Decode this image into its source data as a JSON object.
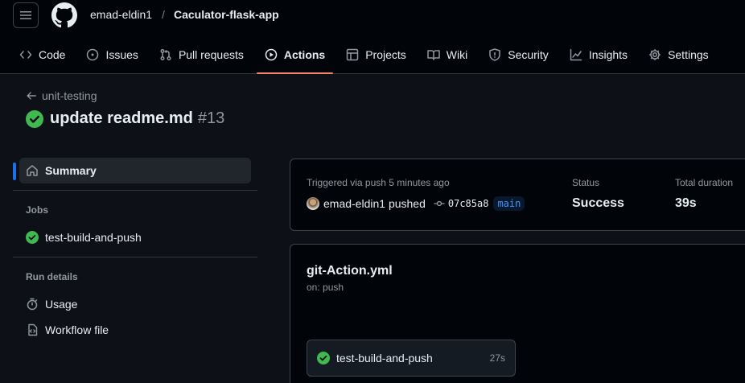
{
  "header": {
    "owner": "emad-eldin1",
    "separator": "/",
    "repo": "Caculator-flask-app"
  },
  "tabs": [
    {
      "label": "Code",
      "icon": "code-icon"
    },
    {
      "label": "Issues",
      "icon": "issue-icon"
    },
    {
      "label": "Pull requests",
      "icon": "pull-request-icon"
    },
    {
      "label": "Actions",
      "icon": "play-icon",
      "active": true
    },
    {
      "label": "Projects",
      "icon": "table-icon"
    },
    {
      "label": "Wiki",
      "icon": "book-icon"
    },
    {
      "label": "Security",
      "icon": "shield-icon"
    },
    {
      "label": "Insights",
      "icon": "graph-icon"
    },
    {
      "label": "Settings",
      "icon": "gear-icon"
    }
  ],
  "run": {
    "back_label": "unit-testing",
    "title": "update readme.md",
    "number": "#13"
  },
  "sidebar": {
    "summary": "Summary",
    "jobs_heading": "Jobs",
    "job": "test-build-and-push",
    "run_details_heading": "Run details",
    "usage": "Usage",
    "workflow_file": "Workflow file"
  },
  "summary_card": {
    "triggered": "Triggered via push 5 minutes ago",
    "pusher": "emad-eldin1 pushed",
    "commit": "07c85a8",
    "branch": "main",
    "status_label": "Status",
    "status_value": "Success",
    "duration_label": "Total duration",
    "duration_value": "39s"
  },
  "workflow_card": {
    "name": "git-Action.yml",
    "trigger": "on: push",
    "job_name": "test-build-and-push",
    "job_duration": "27s"
  },
  "colors": {
    "success": "#3fb950",
    "accent": "#f78166",
    "link": "#4493f8",
    "background": "#0d1117"
  }
}
